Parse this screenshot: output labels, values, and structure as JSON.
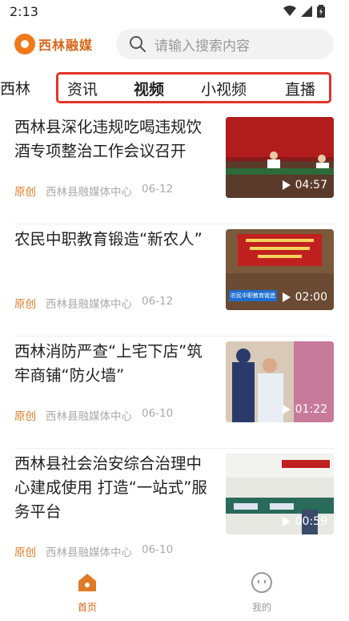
{
  "status_bar": {
    "time": "2:13"
  },
  "header": {
    "logo_text": "西林融媒",
    "search_placeholder": "请输入搜索内容"
  },
  "tabs": {
    "prev_partial": "西林",
    "items": [
      "资讯",
      "视频",
      "小视频",
      "直播"
    ],
    "active": "视频"
  },
  "news": [
    {
      "title": "西林县深化违规吃喝违规饮酒专项整治工作会议召开",
      "tag": "原创",
      "source": "西林县融媒体中心",
      "date": "06-12",
      "duration": "04:57"
    },
    {
      "title": "农民中职教育锻造“新农人”",
      "tag": "原创",
      "source": "西林县融媒体中心",
      "date": "06-12",
      "duration": "02:00",
      "overlay_text": "农民中职教育锻造"
    },
    {
      "title": "西林消防严查“上宅下店”筑牢商铺“防火墙”",
      "tag": "原创",
      "source": "西林县融媒体中心",
      "date": "06-10",
      "duration": "01:22"
    },
    {
      "title": "西林县社会治安综合治理中心建成使用 打造“一站式”服务平台",
      "tag": "原创",
      "source": "西林县融媒体中心",
      "date": "06-10",
      "duration": "00:59"
    }
  ],
  "bottom_nav": {
    "home_label": "首页",
    "mine_label": "我的"
  },
  "colors": {
    "accent": "#e07a26",
    "tab_box": "#e0352b"
  }
}
